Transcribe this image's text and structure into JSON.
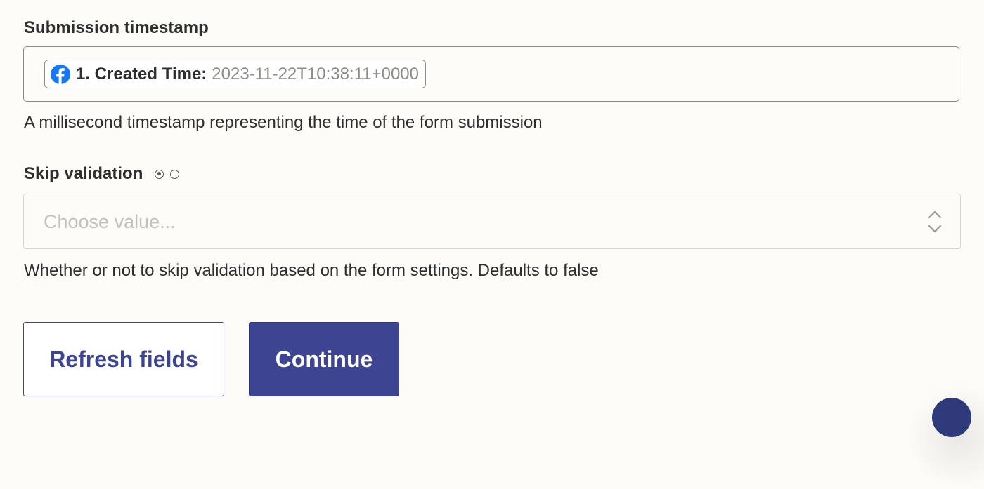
{
  "timestamp_field": {
    "label": "Submission timestamp",
    "pill": {
      "icon": "facebook-icon",
      "key": "1. Created Time:",
      "value": "2023-11-22T10:38:11+0000"
    },
    "help": "A millisecond timestamp representing the time of the form submission"
  },
  "skip_validation_field": {
    "label": "Skip validation",
    "radio_options": [
      "selected",
      "unselected"
    ],
    "placeholder": "Choose value...",
    "help": "Whether or not to skip validation based on the form settings. Defaults to false"
  },
  "buttons": {
    "refresh_label": "Refresh fields",
    "continue_label": "Continue"
  },
  "colors": {
    "background": "#fdfcf9",
    "accent": "#3d4592",
    "facebook": "#1877f2"
  }
}
